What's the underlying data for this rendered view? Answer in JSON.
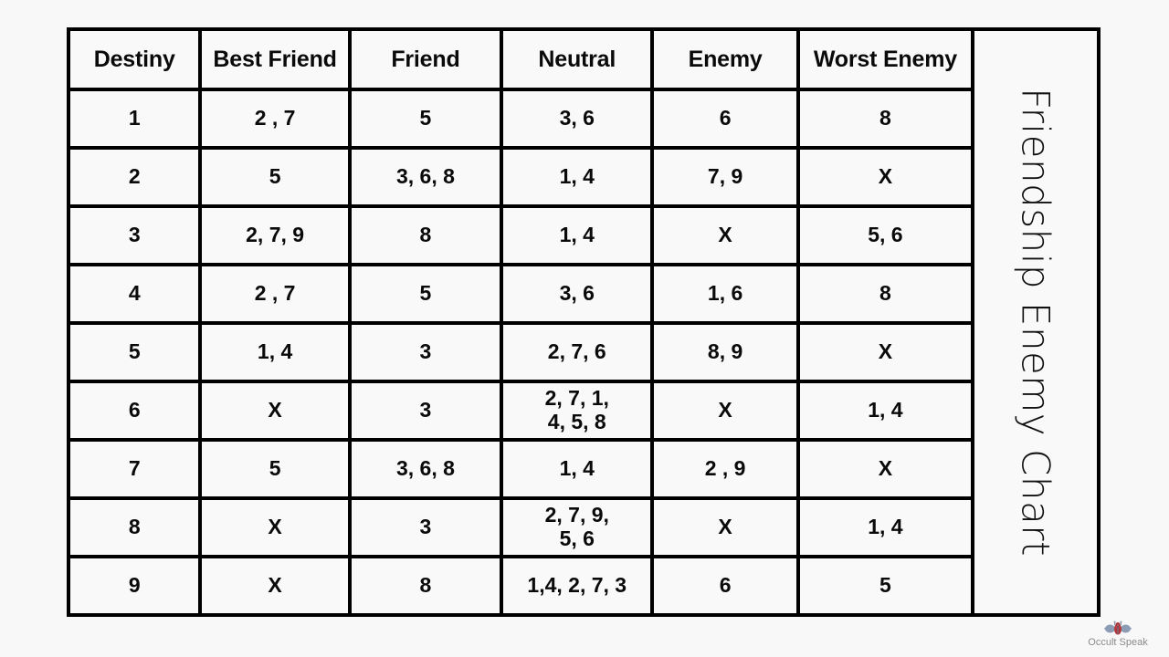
{
  "title": "Friendship Enemy Chart",
  "table": {
    "headers": [
      "Destiny",
      "Best Friend",
      "Friend",
      "Neutral",
      "Enemy",
      "Worst Enemy"
    ],
    "rows": [
      {
        "destiny": "1",
        "best_friend": "2 , 7",
        "friend": "5",
        "neutral": "3, 6",
        "enemy": "6",
        "worst_enemy": "8"
      },
      {
        "destiny": "2",
        "best_friend": "5",
        "friend": "3, 6, 8",
        "neutral": "1, 4",
        "enemy": "7, 9",
        "worst_enemy": "X"
      },
      {
        "destiny": "3",
        "best_friend": "2, 7, 9",
        "friend": "8",
        "neutral": "1, 4",
        "enemy": "X",
        "worst_enemy": "5, 6"
      },
      {
        "destiny": "4",
        "best_friend": "2 , 7",
        "friend": "5",
        "neutral": "3, 6",
        "enemy": "1, 6",
        "worst_enemy": "8"
      },
      {
        "destiny": "5",
        "best_friend": "1, 4",
        "friend": "3",
        "neutral": "2, 7, 6",
        "enemy": "8, 9",
        "worst_enemy": "X"
      },
      {
        "destiny": "6",
        "best_friend": "X",
        "friend": "3",
        "neutral": "2, 7, 1,\n4, 5, 8",
        "enemy": "X",
        "worst_enemy": "1, 4"
      },
      {
        "destiny": "7",
        "best_friend": "5",
        "friend": "3, 6, 8",
        "neutral": "1, 4",
        "enemy": "2 , 9",
        "worst_enemy": "X"
      },
      {
        "destiny": "8",
        "best_friend": "X",
        "friend": "3",
        "neutral": "2, 7, 9,\n5, 6",
        "enemy": "X",
        "worst_enemy": "1, 4"
      },
      {
        "destiny": "9",
        "best_friend": "X",
        "friend": "8",
        "neutral": "1,4, 2, 7, 3",
        "enemy": "6",
        "worst_enemy": "5"
      }
    ]
  },
  "watermark": {
    "label": "Occult Speak",
    "icon": "scarab-emblem-icon"
  },
  "colors": {
    "background": "#f8f8f8",
    "cell_background": "#f9f9f9",
    "border": "#000000",
    "text": "#0a0a0a",
    "watermark_text": "#8a8a8a",
    "emblem_blue": "#8d9cb5",
    "emblem_red": "#b0383a"
  }
}
